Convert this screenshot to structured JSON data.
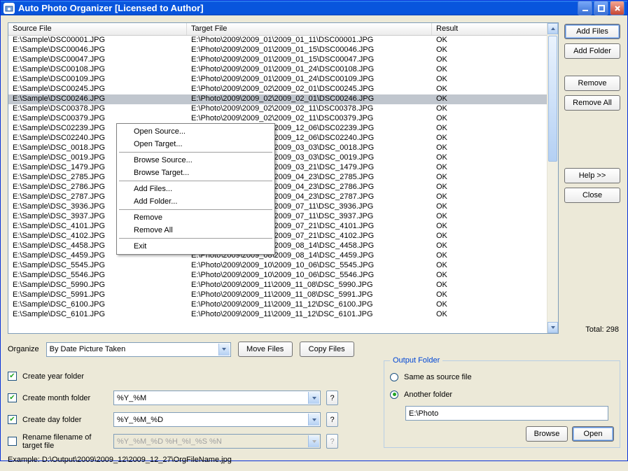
{
  "window_title": "Auto Photo Organizer [Licensed to Author]",
  "columns": {
    "source": "Source File",
    "target": "Target File",
    "result": "Result"
  },
  "rows": [
    {
      "s": "E:\\Sample\\DSC00001.JPG",
      "t": "E:\\Photo\\2009\\2009_01\\2009_01_11\\DSC00001.JPG",
      "r": "OK"
    },
    {
      "s": "E:\\Sample\\DSC00046.JPG",
      "t": "E:\\Photo\\2009\\2009_01\\2009_01_15\\DSC00046.JPG",
      "r": "OK"
    },
    {
      "s": "E:\\Sample\\DSC00047.JPG",
      "t": "E:\\Photo\\2009\\2009_01\\2009_01_15\\DSC00047.JPG",
      "r": "OK"
    },
    {
      "s": "E:\\Sample\\DSC00108.JPG",
      "t": "E:\\Photo\\2009\\2009_01\\2009_01_24\\DSC00108.JPG",
      "r": "OK"
    },
    {
      "s": "E:\\Sample\\DSC00109.JPG",
      "t": "E:\\Photo\\2009\\2009_01\\2009_01_24\\DSC00109.JPG",
      "r": "OK"
    },
    {
      "s": "E:\\Sample\\DSC00245.JPG",
      "t": "E:\\Photo\\2009\\2009_02\\2009_02_01\\DSC00245.JPG",
      "r": "OK"
    },
    {
      "s": "E:\\Sample\\DSC00246.JPG",
      "t": "E:\\Photo\\2009\\2009_02\\2009_02_01\\DSC00246.JPG",
      "r": "OK",
      "sel": true
    },
    {
      "s": "E:\\Sample\\DSC00378.JPG",
      "t": "E:\\Photo\\2009\\2009_02\\2009_02_11\\DSC00378.JPG",
      "r": "OK"
    },
    {
      "s": "E:\\Sample\\DSC00379.JPG",
      "t": "E:\\Photo\\2009\\2009_02\\2009_02_11\\DSC00379.JPG",
      "r": "OK"
    },
    {
      "s": "E:\\Sample\\DSC02239.JPG",
      "t": "E:\\Photo\\2009\\2009_12\\2009_12_06\\DSC02239.JPG",
      "r": "OK"
    },
    {
      "s": "E:\\Sample\\DSC02240.JPG",
      "t": "E:\\Photo\\2009\\2009_12\\2009_12_06\\DSC02240.JPG",
      "r": "OK"
    },
    {
      "s": "E:\\Sample\\DSC_0018.JPG",
      "t": "E:\\Photo\\2009\\2009_03\\2009_03_03\\DSC_0018.JPG",
      "r": "OK"
    },
    {
      "s": "E:\\Sample\\DSC_0019.JPG",
      "t": "E:\\Photo\\2009\\2009_03\\2009_03_03\\DSC_0019.JPG",
      "r": "OK"
    },
    {
      "s": "E:\\Sample\\DSC_1479.JPG",
      "t": "E:\\Photo\\2009\\2009_03\\2009_03_21\\DSC_1479.JPG",
      "r": "OK"
    },
    {
      "s": "E:\\Sample\\DSC_2785.JPG",
      "t": "E:\\Photo\\2009\\2009_04\\2009_04_23\\DSC_2785.JPG",
      "r": "OK"
    },
    {
      "s": "E:\\Sample\\DSC_2786.JPG",
      "t": "E:\\Photo\\2009\\2009_04\\2009_04_23\\DSC_2786.JPG",
      "r": "OK"
    },
    {
      "s": "E:\\Sample\\DSC_2787.JPG",
      "t": "E:\\Photo\\2009\\2009_04\\2009_04_23\\DSC_2787.JPG",
      "r": "OK"
    },
    {
      "s": "E:\\Sample\\DSC_3936.JPG",
      "t": "E:\\Photo\\2009\\2009_07\\2009_07_11\\DSC_3936.JPG",
      "r": "OK"
    },
    {
      "s": "E:\\Sample\\DSC_3937.JPG",
      "t": "E:\\Photo\\2009\\2009_07\\2009_07_11\\DSC_3937.JPG",
      "r": "OK"
    },
    {
      "s": "E:\\Sample\\DSC_4101.JPG",
      "t": "E:\\Photo\\2009\\2009_07\\2009_07_21\\DSC_4101.JPG",
      "r": "OK"
    },
    {
      "s": "E:\\Sample\\DSC_4102.JPG",
      "t": "E:\\Photo\\2009\\2009_07\\2009_07_21\\DSC_4102.JPG",
      "r": "OK"
    },
    {
      "s": "E:\\Sample\\DSC_4458.JPG",
      "t": "E:\\Photo\\2009\\2009_08\\2009_08_14\\DSC_4458.JPG",
      "r": "OK"
    },
    {
      "s": "E:\\Sample\\DSC_4459.JPG",
      "t": "E:\\Photo\\2009\\2009_08\\2009_08_14\\DSC_4459.JPG",
      "r": "OK"
    },
    {
      "s": "E:\\Sample\\DSC_5545.JPG",
      "t": "E:\\Photo\\2009\\2009_10\\2009_10_06\\DSC_5545.JPG",
      "r": "OK"
    },
    {
      "s": "E:\\Sample\\DSC_5546.JPG",
      "t": "E:\\Photo\\2009\\2009_10\\2009_10_06\\DSC_5546.JPG",
      "r": "OK"
    },
    {
      "s": "E:\\Sample\\DSC_5990.JPG",
      "t": "E:\\Photo\\2009\\2009_11\\2009_11_08\\DSC_5990.JPG",
      "r": "OK"
    },
    {
      "s": "E:\\Sample\\DSC_5991.JPG",
      "t": "E:\\Photo\\2009\\2009_11\\2009_11_08\\DSC_5991.JPG",
      "r": "OK"
    },
    {
      "s": "E:\\Sample\\DSC_6100.JPG",
      "t": "E:\\Photo\\2009\\2009_11\\2009_11_12\\DSC_6100.JPG",
      "r": "OK"
    },
    {
      "s": "E:\\Sample\\DSC_6101.JPG",
      "t": "E:\\Photo\\2009\\2009_11\\2009_11_12\\DSC_6101.JPG",
      "r": "OK"
    }
  ],
  "side": {
    "add_files": "Add Files",
    "add_folder": "Add Folder",
    "remove": "Remove",
    "remove_all": "Remove All",
    "help": "Help >>",
    "close": "Close",
    "total": "Total: 298"
  },
  "context": {
    "open_source": "Open Source...",
    "open_target": "Open Target...",
    "browse_source": "Browse Source...",
    "browse_target": "Browse Target...",
    "add_files": "Add Files...",
    "add_folder": "Add Folder...",
    "remove": "Remove",
    "remove_all": "Remove All",
    "exit": "Exit"
  },
  "mid": {
    "organize_label": "Organize",
    "organize_value": "By Date Picture Taken",
    "move_files": "Move Files",
    "copy_files": "Copy Files"
  },
  "opts": {
    "year": "Create year folder",
    "month": "Create month folder",
    "month_fmt": "%Y_%M",
    "day": "Create day folder",
    "day_fmt": "%Y_%M_%D",
    "rename": "Rename filename of target file",
    "rename_fmt": "%Y_%M_%D %H_%I_%S %N"
  },
  "outf": {
    "legend": "Output Folder",
    "same": "Same as source file",
    "another": "Another folder",
    "path": "E:\\Photo",
    "browse": "Browse",
    "open": "Open"
  },
  "example": "Example: D:\\Output\\2009\\2009_12\\2009_12_27\\OrgFileName.jpg"
}
